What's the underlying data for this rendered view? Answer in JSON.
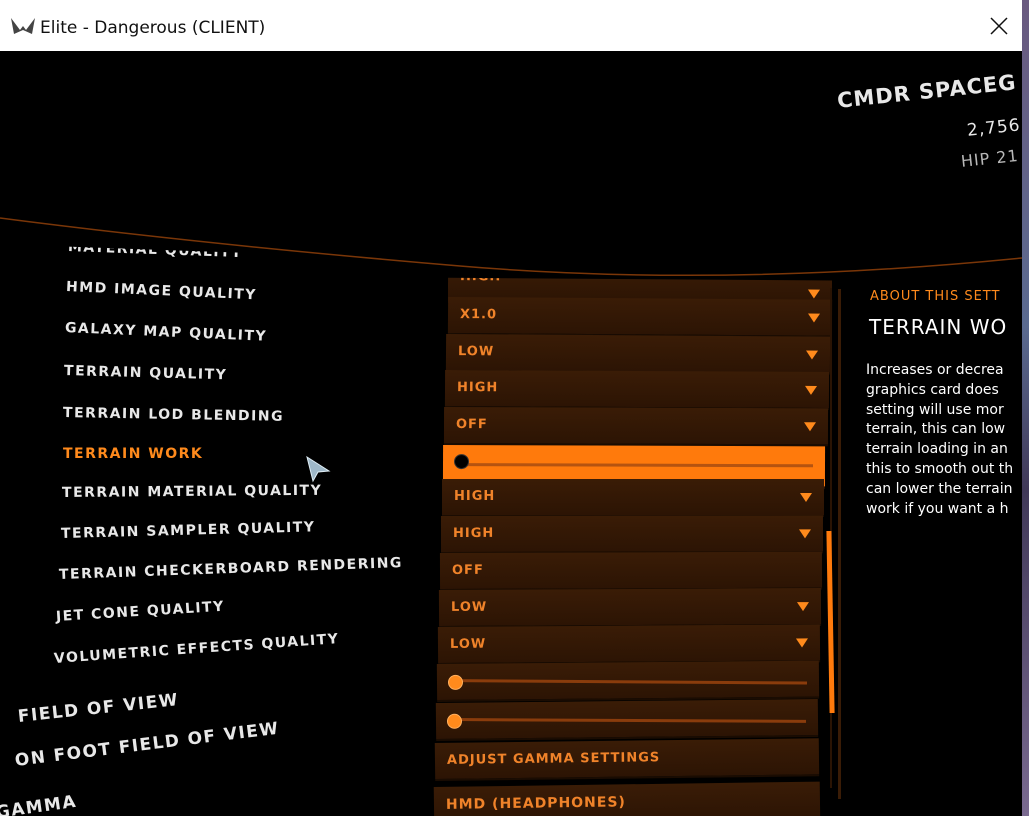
{
  "window": {
    "title": "Elite - Dangerous (CLIENT)",
    "close_label": "✕"
  },
  "commander": {
    "name": "CMDR SPACEG",
    "credits": "2,756",
    "location": "HIP 21"
  },
  "settings": {
    "rows": [
      {
        "label": "MATERIAL QUALITY",
        "value": "HIGH",
        "type": "dropdown"
      },
      {
        "label": "HMD IMAGE QUALITY",
        "value": "X1.0",
        "type": "dropdown"
      },
      {
        "label": "GALAXY MAP QUALITY",
        "value": "LOW",
        "type": "dropdown"
      },
      {
        "label": "TERRAIN QUALITY",
        "value": "HIGH",
        "type": "dropdown"
      },
      {
        "label": "TERRAIN LOD BLENDING",
        "value": "OFF",
        "type": "dropdown"
      },
      {
        "label": "TERRAIN WORK",
        "value": "",
        "type": "slider",
        "level": 0.0
      },
      {
        "label": "TERRAIN MATERIAL QUALITY",
        "value": "HIGH",
        "type": "dropdown"
      },
      {
        "label": "TERRAIN SAMPLER QUALITY",
        "value": "HIGH",
        "type": "dropdown"
      },
      {
        "label": "TERRAIN CHECKERBOARD RENDERING",
        "value": "OFF",
        "type": "toggle"
      },
      {
        "label": "JET CONE QUALITY",
        "value": "LOW",
        "type": "dropdown"
      },
      {
        "label": "VOLUMETRIC EFFECTS QUALITY",
        "value": "LOW",
        "type": "dropdown"
      },
      {
        "label": "FIELD OF VIEW",
        "value": "",
        "type": "slider",
        "level": 0.0
      },
      {
        "label": "ON FOOT FIELD OF VIEW",
        "value": "",
        "type": "slider",
        "level": 0.0
      },
      {
        "label": "GAMMA",
        "value": "ADJUST GAMMA SETTINGS",
        "type": "button"
      },
      {
        "label": "",
        "value": "HMD (HEADPHONES)",
        "type": "dropdown"
      }
    ],
    "selected_index": 5
  },
  "about": {
    "heading": "ABOUT THIS SETT",
    "title": "TERRAIN WO",
    "lines": [
      "Increases or decrea",
      "graphics card does",
      "setting will use mor",
      "terrain, this can low",
      "terrain loading in an",
      "this to smooth out th",
      "can lower the terrain",
      "work if you want a h"
    ]
  },
  "colors": {
    "accent": "#ff8a1c",
    "row_bg": "#3a1c06",
    "text": "#e8e8e8"
  },
  "icons": {
    "app": "elite-wings-icon",
    "close": "close-icon",
    "dropdown": "dropdown-arrow-icon",
    "cursor": "mouse-cursor-icon"
  }
}
